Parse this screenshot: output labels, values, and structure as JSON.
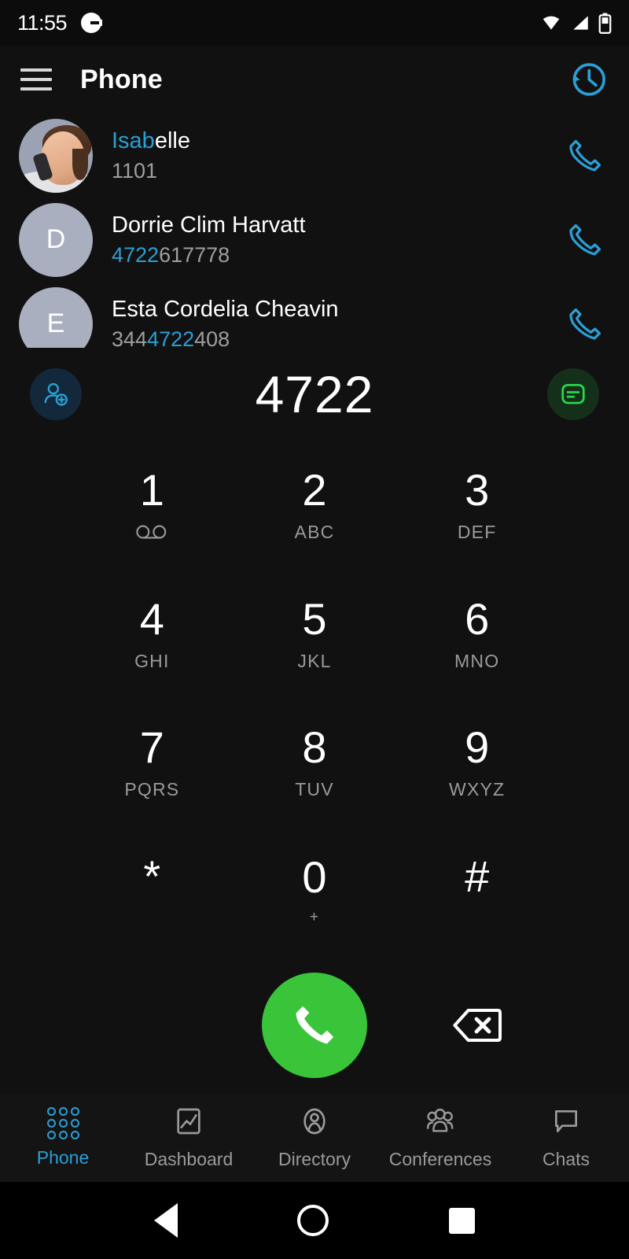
{
  "status_bar": {
    "time": "11:55",
    "icons": [
      "app-notification-icon",
      "wifi-icon",
      "cell-signal-icon",
      "battery-icon"
    ]
  },
  "toolbar": {
    "menu_icon": "hamburger-menu-icon",
    "title": "Phone",
    "action_icon": "call-history-icon"
  },
  "contacts": [
    {
      "avatar_type": "photo",
      "avatar_letter": "",
      "name_prefix": "Isab",
      "name_suffix": "elle",
      "number_prefix": "",
      "number_match": "",
      "number_suffix": "1101",
      "call_icon": "call-icon"
    },
    {
      "avatar_type": "letter",
      "avatar_letter": "D",
      "name_prefix": "",
      "name_suffix": "Dorrie Clim Harvatt",
      "number_prefix": "",
      "number_match": "4722",
      "number_suffix": "617778",
      "call_icon": "call-icon"
    },
    {
      "avatar_type": "letter",
      "avatar_letter": "E",
      "name_prefix": "",
      "name_suffix": "Esta Cordelia Cheavin",
      "number_prefix": "344",
      "number_match": "4722",
      "number_suffix": "408",
      "call_icon": "call-icon"
    }
  ],
  "dial": {
    "add_contact_icon": "add-contact-icon",
    "dialed_number": "4722",
    "message_icon": "message-icon"
  },
  "keypad": [
    {
      "digit": "1",
      "sub": "",
      "icon": "voicemail-icon"
    },
    {
      "digit": "2",
      "sub": "ABC",
      "icon": ""
    },
    {
      "digit": "3",
      "sub": "DEF",
      "icon": ""
    },
    {
      "digit": "4",
      "sub": "GHI",
      "icon": ""
    },
    {
      "digit": "5",
      "sub": "JKL",
      "icon": ""
    },
    {
      "digit": "6",
      "sub": "MNO",
      "icon": ""
    },
    {
      "digit": "7",
      "sub": "PQRS",
      "icon": ""
    },
    {
      "digit": "8",
      "sub": "TUV",
      "icon": ""
    },
    {
      "digit": "9",
      "sub": "WXYZ",
      "icon": ""
    },
    {
      "digit": "*",
      "sub": "",
      "icon": ""
    },
    {
      "digit": "0",
      "sub": "+",
      "icon": ""
    },
    {
      "digit": "#",
      "sub": "",
      "icon": ""
    }
  ],
  "actions": {
    "call_icon": "call-icon",
    "backspace_icon": "backspace-icon"
  },
  "bottom_nav": {
    "active": "Phone",
    "items": [
      {
        "label": "Phone",
        "icon": "dialpad-icon"
      },
      {
        "label": "Dashboard",
        "icon": "chart-icon"
      },
      {
        "label": "Directory",
        "icon": "person-icon"
      },
      {
        "label": "Conferences",
        "icon": "group-icon"
      },
      {
        "label": "Chats",
        "icon": "chat-bubble-icon"
      }
    ]
  },
  "system_nav": {
    "back": "back-button",
    "home": "home-button",
    "recents": "recents-button"
  },
  "colors": {
    "accent_blue": "#2a9fd6",
    "call_green": "#3ac43a",
    "background": "#111111",
    "muted_text": "#9a9a9a"
  }
}
